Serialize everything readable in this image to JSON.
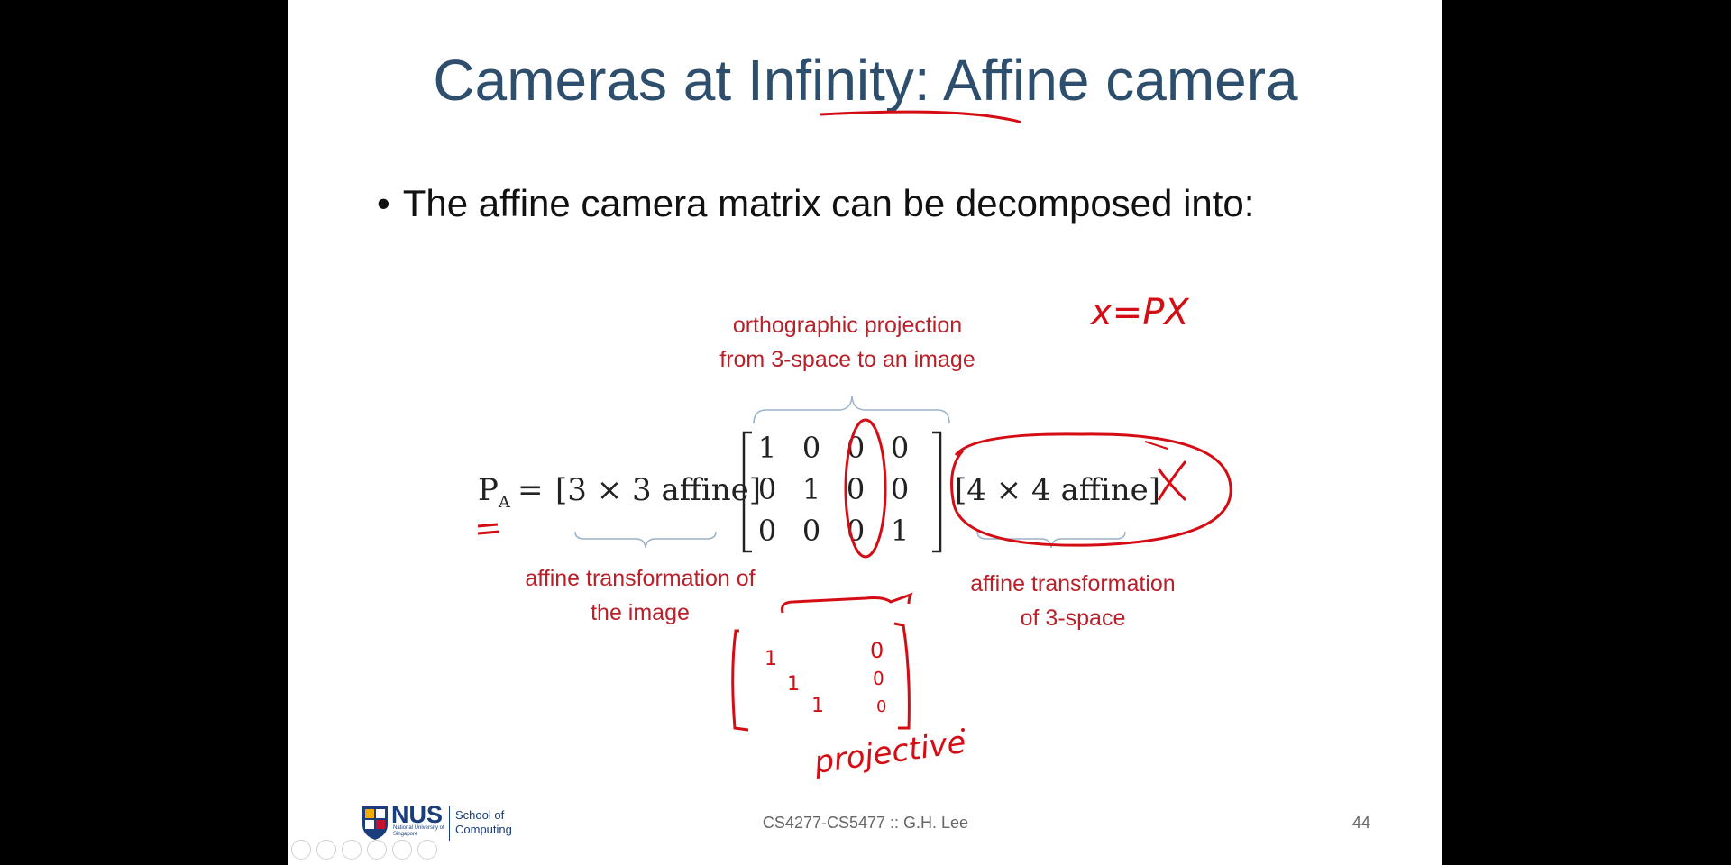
{
  "slide": {
    "title": "Cameras at Infinity: Affine camera",
    "bullet": "The affine camera matrix can be decomposed into:",
    "labels": {
      "orthographic": [
        "orthographic projection",
        "from 3-space to an image"
      ],
      "affine_image": [
        "affine transformation of",
        "the image"
      ],
      "affine_space": [
        "affine transformation",
        "of 3-space"
      ]
    },
    "equation": {
      "lhs": "P",
      "lhs_sub": "A",
      "equals": "=",
      "left_factor": "[3 × 3 affine]",
      "right_factor": "[4 × 4 affine]",
      "matrix": [
        [
          "1",
          "0",
          "0",
          "0"
        ],
        [
          "0",
          "1",
          "0",
          "0"
        ],
        [
          "0",
          "0",
          "0",
          "1"
        ]
      ]
    },
    "annotations": {
      "formula": "x=PX",
      "cross": "X",
      "word": "projective",
      "sketch_entries": [
        "1",
        "1",
        "1",
        "0",
        "0",
        "0"
      ]
    },
    "footer": {
      "course": "CS4277-CS5477 :: G.H. Lee",
      "page": "44",
      "logo_text": "NUS",
      "logo_subtext": "National University of Singapore",
      "school_line1": "School of",
      "school_line2": "Computing"
    },
    "colors": {
      "title": "#2e4e6e",
      "label_red": "#b8202a",
      "ink_red": "#d40d14"
    }
  }
}
